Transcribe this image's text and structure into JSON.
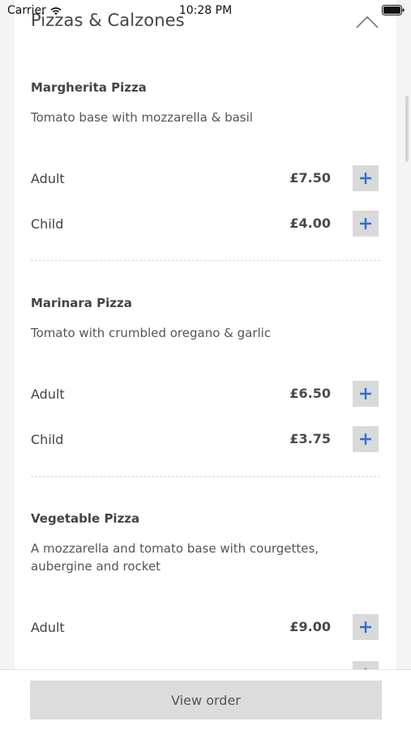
{
  "status_bar": {
    "carrier": "Carrier",
    "time": "10:28 PM"
  },
  "section": {
    "title": "Pizzas & Calzones"
  },
  "items": [
    {
      "name": "Margherita Pizza",
      "description": "Tomato base with mozzarella & basil",
      "options": [
        {
          "label": "Adult",
          "price": "£7.50"
        },
        {
          "label": "Child",
          "price": "£4.00"
        }
      ]
    },
    {
      "name": "Marinara Pizza",
      "description": "Tomato with crumbled oregano & garlic",
      "options": [
        {
          "label": "Adult",
          "price": "£6.50"
        },
        {
          "label": "Child",
          "price": "£3.75"
        }
      ]
    },
    {
      "name": "Vegetable Pizza",
      "description": "A mozzarella and tomato base with courgettes, aubergine and rocket",
      "options": [
        {
          "label": "Adult",
          "price": "£9.00"
        }
      ]
    }
  ],
  "footer": {
    "view_order_label": "View order"
  },
  "colors": {
    "accent": "#2f6fd0",
    "button_bg": "#d9d9d9",
    "page_bg": "#f4f4f4"
  },
  "icons": {
    "add": "plus-icon",
    "collapse": "chevron-up-icon",
    "wifi": "wifi-icon",
    "battery": "battery-icon"
  }
}
